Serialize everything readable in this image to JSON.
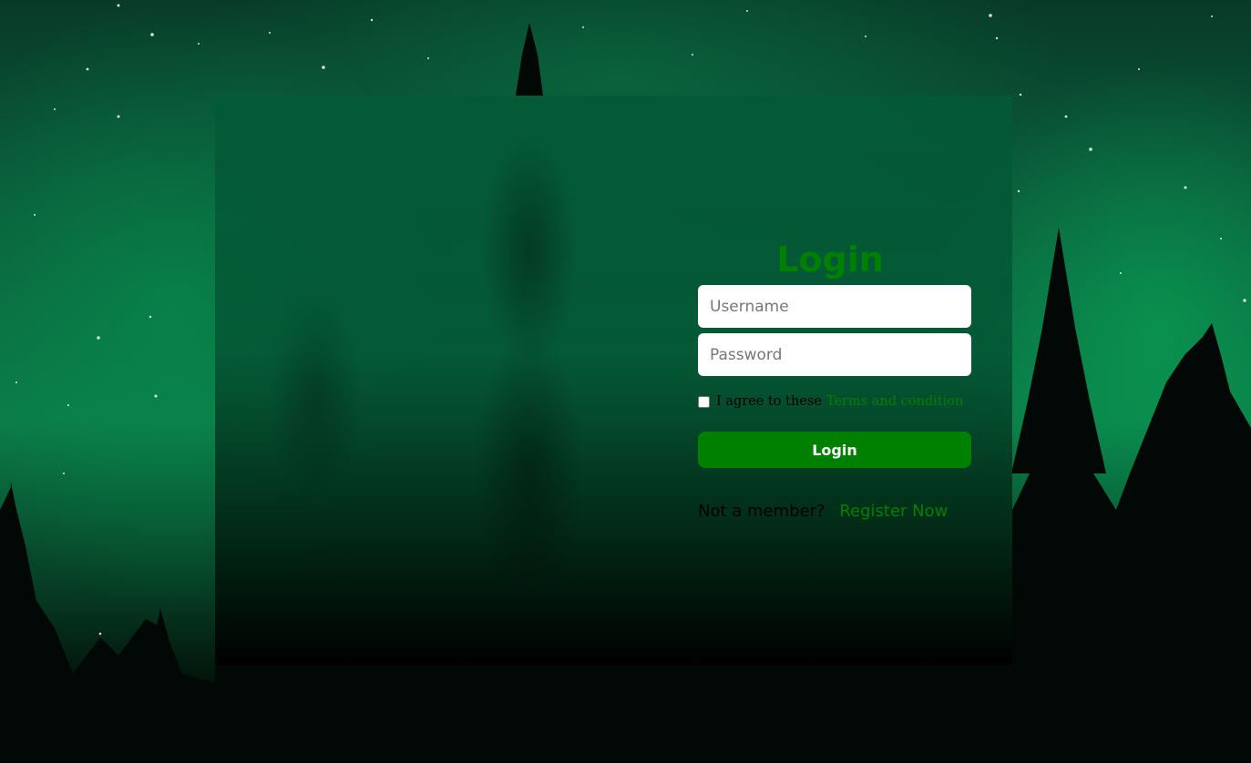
{
  "background": {
    "description_colors": {
      "aurora_green": "#0b8a4e",
      "night_sky": "#083a28",
      "forest_black": "#000000"
    }
  },
  "login_form": {
    "title": "Login",
    "username": {
      "value": "",
      "placeholder": "Username"
    },
    "password": {
      "value": "",
      "placeholder": "Password"
    },
    "terms": {
      "checked": false,
      "text": "I agree to these",
      "link_label": "Terms and condition"
    },
    "submit_label": "Login",
    "register": {
      "prompt": "Not a member?",
      "link_label": "Register Now"
    }
  },
  "colors": {
    "accent": "#008000",
    "button_text": "#ffffff",
    "input_background": "#ffffff"
  }
}
